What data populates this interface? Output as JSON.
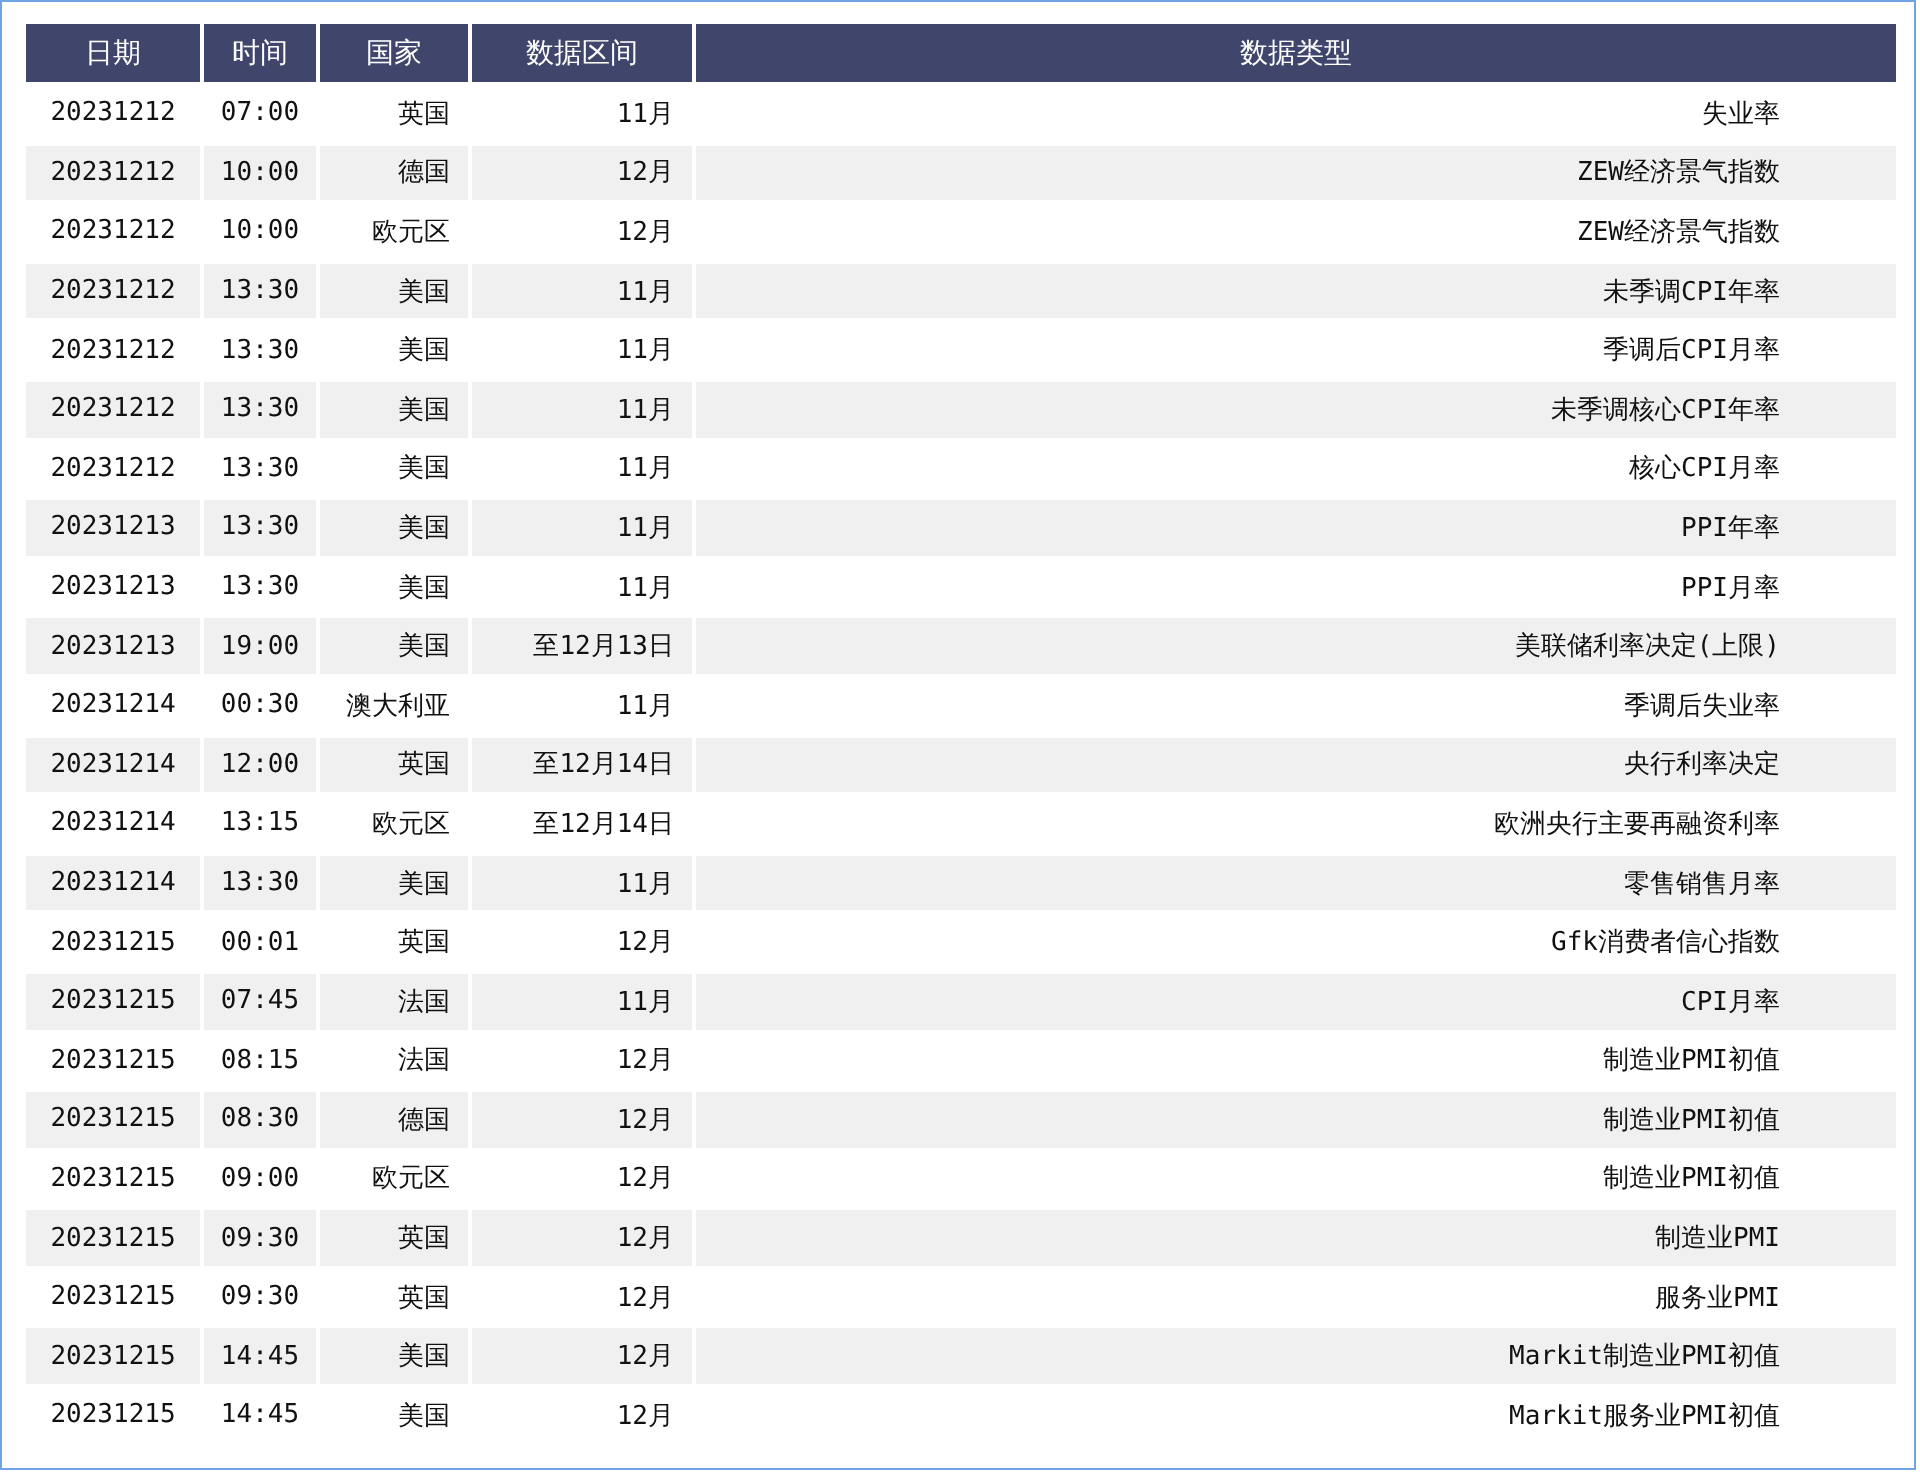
{
  "table": {
    "columns": [
      "日期",
      "时间",
      "国家",
      "数据区间",
      "数据类型"
    ],
    "rows": [
      [
        "20231212",
        "07:00",
        "英国",
        "11月",
        "失业率"
      ],
      [
        "20231212",
        "10:00",
        "德国",
        "12月",
        "ZEW经济景气指数"
      ],
      [
        "20231212",
        "10:00",
        "欧元区",
        "12月",
        "ZEW经济景气指数"
      ],
      [
        "20231212",
        "13:30",
        "美国",
        "11月",
        "未季调CPI年率"
      ],
      [
        "20231212",
        "13:30",
        "美国",
        "11月",
        "季调后CPI月率"
      ],
      [
        "20231212",
        "13:30",
        "美国",
        "11月",
        "未季调核心CPI年率"
      ],
      [
        "20231212",
        "13:30",
        "美国",
        "11月",
        "核心CPI月率"
      ],
      [
        "20231213",
        "13:30",
        "美国",
        "11月",
        "PPI年率"
      ],
      [
        "20231213",
        "13:30",
        "美国",
        "11月",
        "PPI月率"
      ],
      [
        "20231213",
        "19:00",
        "美国",
        "至12月13日",
        "美联储利率决定(上限)"
      ],
      [
        "20231214",
        "00:30",
        "澳大利亚",
        "11月",
        "季调后失业率"
      ],
      [
        "20231214",
        "12:00",
        "英国",
        "至12月14日",
        "央行利率决定"
      ],
      [
        "20231214",
        "13:15",
        "欧元区",
        "至12月14日",
        "欧洲央行主要再融资利率"
      ],
      [
        "20231214",
        "13:30",
        "美国",
        "11月",
        "零售销售月率"
      ],
      [
        "20231215",
        "00:01",
        "英国",
        "12月",
        "Gfk消费者信心指数"
      ],
      [
        "20231215",
        "07:45",
        "法国",
        "11月",
        "CPI月率"
      ],
      [
        "20231215",
        "08:15",
        "法国",
        "12月",
        "制造业PMI初值"
      ],
      [
        "20231215",
        "08:30",
        "德国",
        "12月",
        "制造业PMI初值"
      ],
      [
        "20231215",
        "09:00",
        "欧元区",
        "12月",
        "制造业PMI初值"
      ],
      [
        "20231215",
        "09:30",
        "英国",
        "12月",
        "制造业PMI"
      ],
      [
        "20231215",
        "09:30",
        "英国",
        "12月",
        "服务业PMI"
      ],
      [
        "20231215",
        "14:45",
        "美国",
        "12月",
        "Markit制造业PMI初值"
      ],
      [
        "20231215",
        "14:45",
        "美国",
        "12月",
        "Markit服务业PMI初值"
      ]
    ]
  }
}
